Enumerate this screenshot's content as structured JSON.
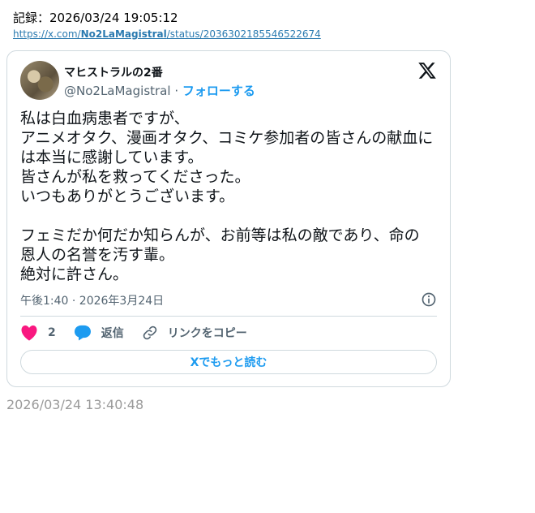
{
  "record": {
    "text": "記録：2026/03/24 19:05:12"
  },
  "url": {
    "prefix": "https://x.com/",
    "handle": "No2LaMagistral",
    "suffix": "/status/2036302185546522674"
  },
  "tweet": {
    "display_name": "マヒストラルの2番",
    "handle": "@No2LaMagistral",
    "separator": " · ",
    "follow_label": "フォローする",
    "body": "私は白血病患者ですが、\nアニメオタク、漫画オタク、コミケ参加者の皆さんの献血には本当に感謝しています。\n皆さんが私を救ってくださった。\nいつもありがとうございます。\n\nフェミだか何だか知らんが、お前等は私の敵であり、命の恩人の名誉を汚す輩。\n絶対に許さん。",
    "timestamp": "午後1:40 · 2026年3月24日",
    "like_count": "2",
    "reply_label": "返信",
    "copy_link_label": "リンクをコピー",
    "read_more_label": "Xでもっと読む"
  },
  "footer": {
    "timestamp": "2026/03/24 13:40:48"
  },
  "colors": {
    "accent": "#1d9bf0",
    "like": "#f91880",
    "link": "#2a7ab0",
    "muted": "#536471"
  }
}
